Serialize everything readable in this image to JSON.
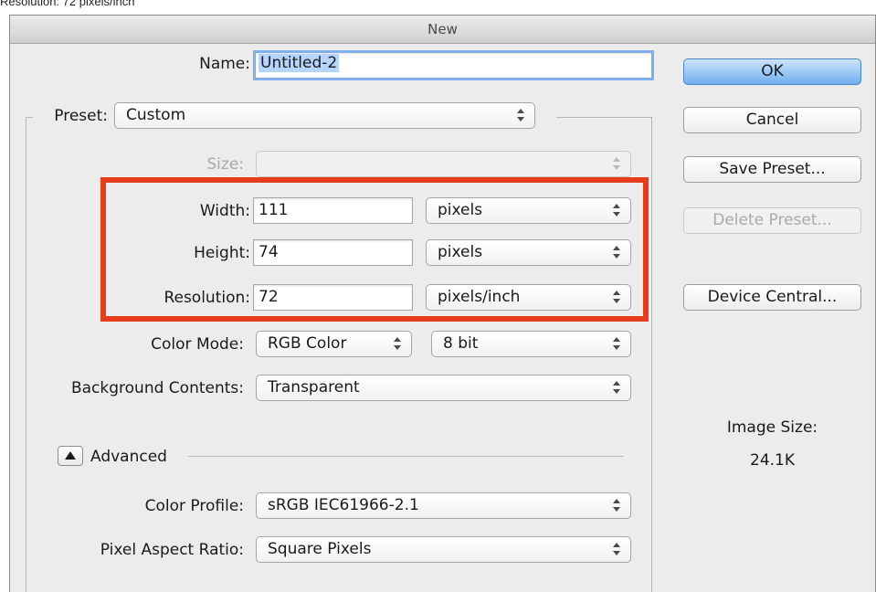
{
  "caption": "Resolution: 72 pixels/inch",
  "window": {
    "title": "New"
  },
  "form": {
    "name": {
      "label": "Name:",
      "value": "Untitled-2"
    },
    "preset": {
      "label": "Preset:",
      "value": "Custom"
    },
    "size": {
      "label": "Size:",
      "value": ""
    },
    "width": {
      "label": "Width:",
      "value": "111",
      "unit": "pixels"
    },
    "height": {
      "label": "Height:",
      "value": "74",
      "unit": "pixels"
    },
    "resolution": {
      "label": "Resolution:",
      "value": "72",
      "unit": "pixels/inch"
    },
    "color_mode": {
      "label": "Color Mode:",
      "value": "RGB Color",
      "depth": "8 bit"
    },
    "background": {
      "label": "Background Contents:",
      "value": "Transparent"
    },
    "advanced": {
      "label": "Advanced",
      "expanded": true
    },
    "color_profile": {
      "label": "Color Profile:",
      "value": "sRGB IEC61966-2.1"
    },
    "pixel_aspect": {
      "label": "Pixel Aspect Ratio:",
      "value": "Square Pixels"
    }
  },
  "buttons": {
    "ok": "OK",
    "cancel": "Cancel",
    "save_preset": "Save Preset...",
    "delete_preset": "Delete Preset...",
    "device_central": "Device Central..."
  },
  "image_size": {
    "label": "Image Size:",
    "value": "24.1K"
  },
  "colors": {
    "highlight": "#e83d1d",
    "default_button": "#6fb0ef",
    "selection": "#b5d5ff"
  },
  "icons": {
    "disclosure": "triangle-up-icon",
    "select_arrows": "up-down-arrows-icon"
  }
}
